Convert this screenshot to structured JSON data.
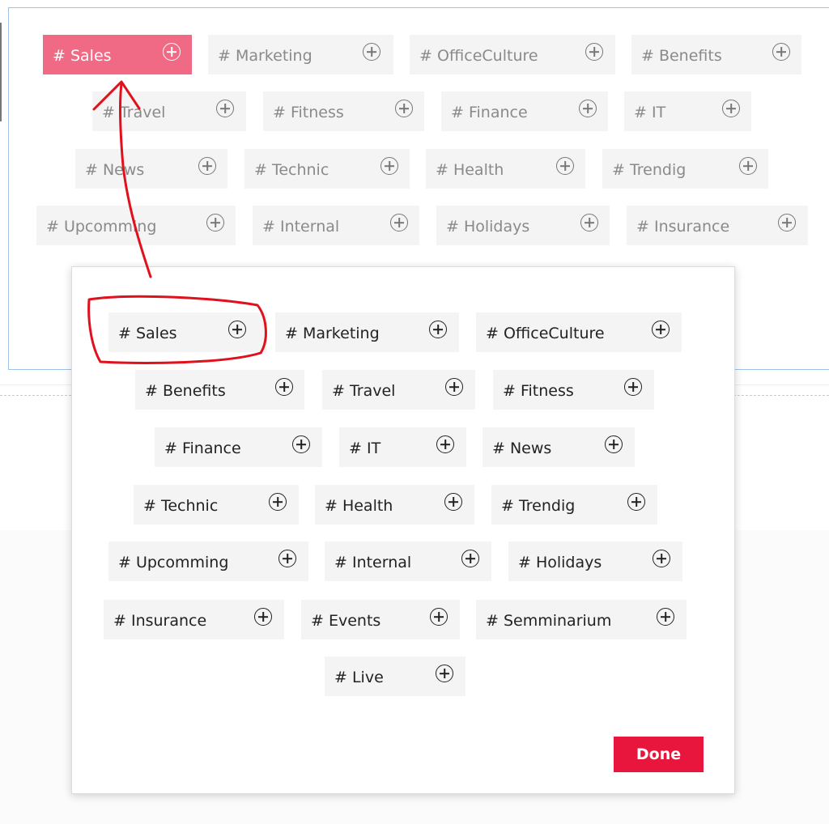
{
  "background_tags": [
    {
      "label": "# Sales",
      "active": true
    },
    {
      "label": "# Marketing"
    },
    {
      "label": "# OfficeCulture"
    },
    {
      "label": "# Benefits"
    },
    {
      "label": "# Travel"
    },
    {
      "label": "# Fitness"
    },
    {
      "label": "# Finance"
    },
    {
      "label": "# IT"
    },
    {
      "label": "# News"
    },
    {
      "label": "# Technic"
    },
    {
      "label": "# Health"
    },
    {
      "label": "# Trendig"
    },
    {
      "label": "# Upcomming"
    },
    {
      "label": "# Internal"
    },
    {
      "label": "# Holidays"
    },
    {
      "label": "# Insurance"
    }
  ],
  "modal": {
    "tags": [
      {
        "label": "# Sales"
      },
      {
        "label": "# Marketing"
      },
      {
        "label": "# OfficeCulture"
      },
      {
        "label": "# Benefits"
      },
      {
        "label": "# Travel"
      },
      {
        "label": "# Fitness"
      },
      {
        "label": "# Finance"
      },
      {
        "label": "# IT"
      },
      {
        "label": "# News"
      },
      {
        "label": "# Technic"
      },
      {
        "label": "# Health"
      },
      {
        "label": "# Trendig"
      },
      {
        "label": "# Upcomming"
      },
      {
        "label": "# Internal"
      },
      {
        "label": "# Holidays"
      },
      {
        "label": "# Insurance"
      },
      {
        "label": "# Events"
      },
      {
        "label": "# Semminarium"
      },
      {
        "label": "# Live"
      }
    ],
    "done_label": "Done"
  },
  "colors": {
    "active_tag": "#f06a86",
    "done_button": "#e8163c",
    "annotation": "#e0101d"
  }
}
